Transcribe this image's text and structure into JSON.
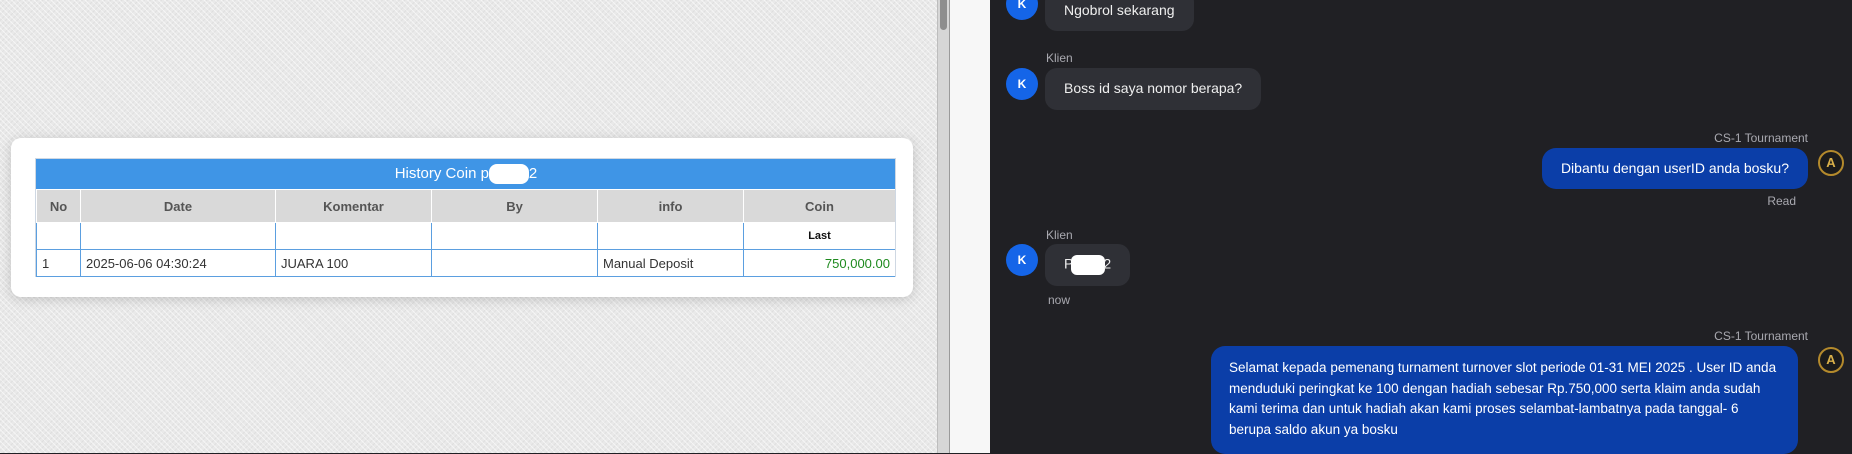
{
  "history": {
    "title_prefix": "History Coin p",
    "title_suffix": "2",
    "columns": [
      "No",
      "Date",
      "Komentar",
      "By",
      "info",
      "Coin"
    ],
    "subheader": "Last",
    "rows": [
      {
        "no": "1",
        "date": "2025-06-06 04:30:24",
        "komentar": "JUARA 100",
        "by": "",
        "info": "Manual Deposit",
        "coin": "750,000.00"
      }
    ]
  },
  "chat": {
    "messages": [
      {
        "sender": "",
        "avatar": "K",
        "text": "Ngobrol sekarang"
      },
      {
        "sender": "Klien",
        "avatar": "K",
        "text": "Boss id saya nomor berapa?"
      },
      {
        "sender": "CS-1 Tournament",
        "avatar": "A",
        "text": "Dibantu dengan userID anda bosku?",
        "status": "Read"
      },
      {
        "sender": "Klien",
        "avatar": "K",
        "text_prefix": "P",
        "text_suffix": "2",
        "time": "now"
      },
      {
        "sender": "CS-1 Tournament",
        "avatar": "A",
        "text": "Selamat kepada pemenang turnament turnover slot periode 01-31 MEI 2025 . User ID anda menduduki peringkat ke 100 dengan hadiah sebesar Rp.750,000 serta klaim anda sudah kami terima dan untuk hadiah akan kami proses selambat-lambatnya pada tanggal- 6 berupa saldo akun ya bosku"
      }
    ]
  },
  "colors": {
    "client_avatar": "#1565e8",
    "agent_bubble": "#0b3ea8",
    "table_header": "#3f95e6",
    "coin_text": "#1e8a1e"
  }
}
